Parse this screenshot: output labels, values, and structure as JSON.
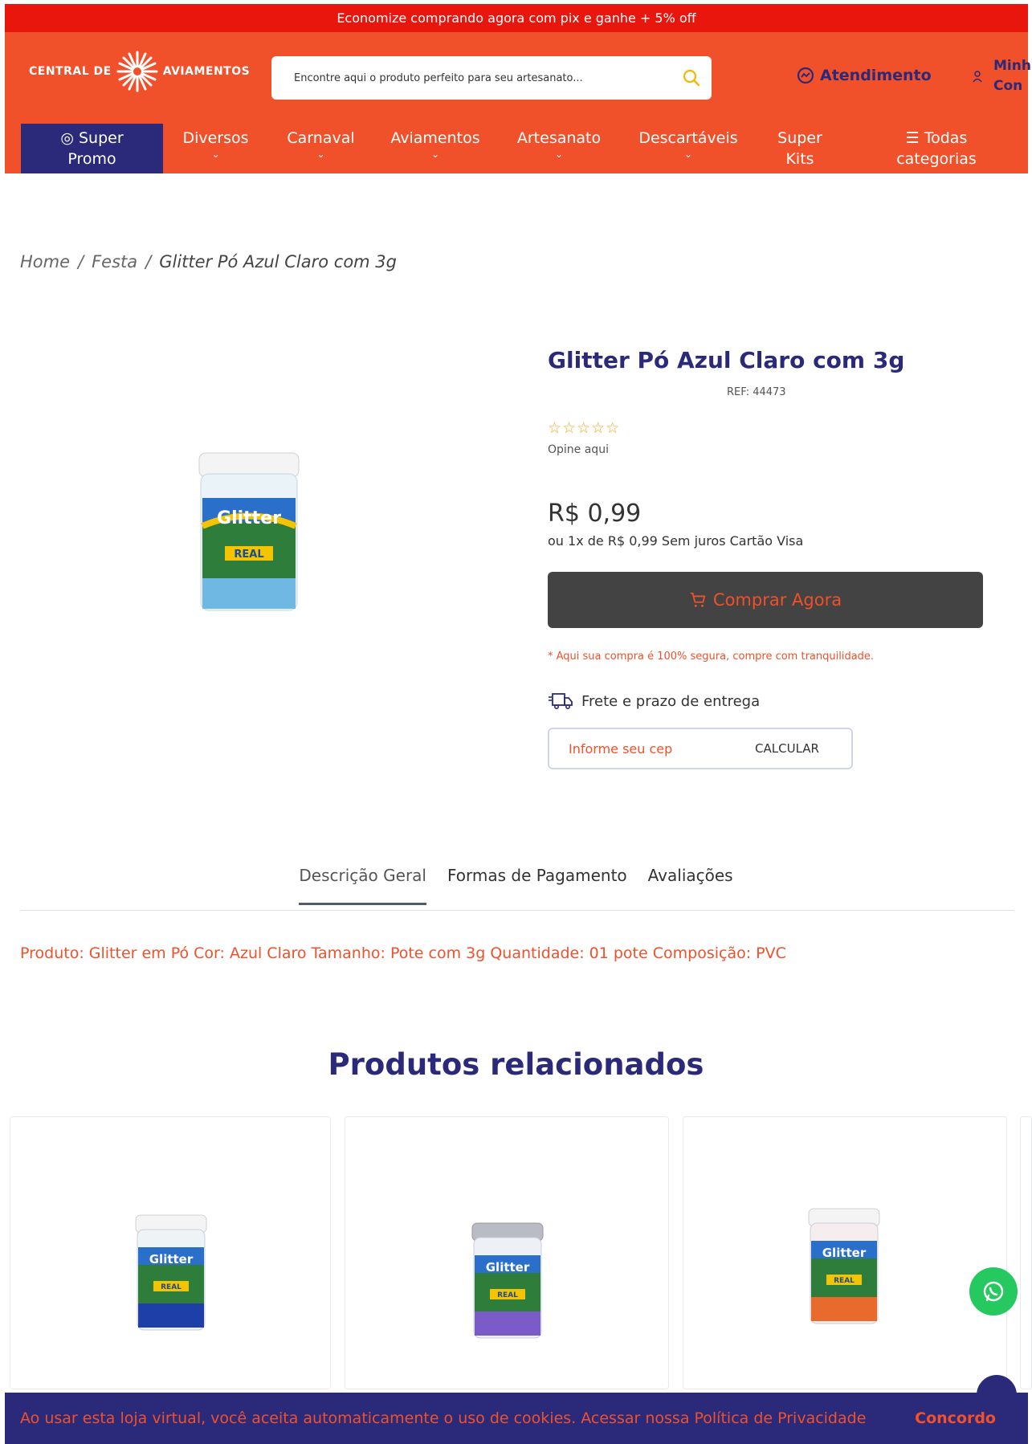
{
  "promo_bar": {
    "text": "Economize comprando agora com pix e ganhe + 5% off"
  },
  "header": {
    "logo_left": "CENTRAL DE",
    "logo_right": "AVIAMENTOS",
    "search_placeholder": "Encontre aqui o produto perfeito para seu artesanato...",
    "attendance_label": "Atendimento",
    "account_line1": "Minh",
    "account_line2": "Con"
  },
  "nav": {
    "items": [
      {
        "line1": "Super",
        "line2": "Promo",
        "icon": "fire-icon"
      },
      {
        "line1": "Diversos",
        "chevron": "⌄"
      },
      {
        "line1": "Carnaval",
        "chevron": "⌄"
      },
      {
        "line1": "Aviamentos",
        "chevron": "⌄"
      },
      {
        "line1": "Artesanato",
        "chevron": "⌄"
      },
      {
        "line1": "Descartáveis",
        "chevron": "⌄"
      },
      {
        "line1": "Super",
        "line2": "Kits"
      },
      {
        "line1": "Todas",
        "line2": "categorias",
        "icon": "menu-icon"
      }
    ]
  },
  "breadcrumb": {
    "home": "Home",
    "sep": "/",
    "category": "Festa",
    "current": "Glitter Pó Azul Claro com 3g"
  },
  "product": {
    "title": "Glitter Pó Azul Claro com 3g",
    "ref": "REF:  44473",
    "rating_stars": "☆☆☆☆☆",
    "rating_link": "Opine aqui",
    "price": "R$ 0,99",
    "installments": "ou 1x de R$ 0,99 Sem juros Cartão Visa",
    "buy_button": "Comprar Agora",
    "secure_note": "* Aqui sua compra é 100% segura, compre com tranquilidade.",
    "shipping_label": "Frete e prazo de entrega",
    "cep_placeholder": "Informe seu cep",
    "cep_button": "CALCULAR",
    "image_label": "Glitter",
    "image_brand": "REAL"
  },
  "tabs": [
    {
      "label": "Descrição Geral",
      "active": true
    },
    {
      "label": "Formas de Pagamento",
      "active": false
    },
    {
      "label": "Avaliações",
      "active": false
    }
  ],
  "description": "Produto: Glitter em Pó Cor: Azul Claro Tamanho: Pote com 3g Quantidade: 01 pote Composição: PVC",
  "related": {
    "title": "Produtos relacionados",
    "items": [
      {
        "image_label": "Glitter",
        "brand": "REAL",
        "color": "#1f3fa8"
      },
      {
        "image_label": "Glitter",
        "brand": "REAL",
        "color": "#7a5bc8"
      },
      {
        "image_label": "Glitter",
        "brand": "REAL",
        "color": "#e86a2c"
      }
    ]
  },
  "cookie": {
    "text": "Ao usar esta loja virtual, você aceita automaticamente o uso de cookies. Acessar nossa Política de Privacidade",
    "agree": "Concordo"
  },
  "colors": {
    "brand_orange": "#f0502a",
    "brand_navy": "#2b2a7a",
    "promo_red": "#e8160c",
    "buy_button_bg": "#434343",
    "whatsapp_green": "#25c95f"
  }
}
